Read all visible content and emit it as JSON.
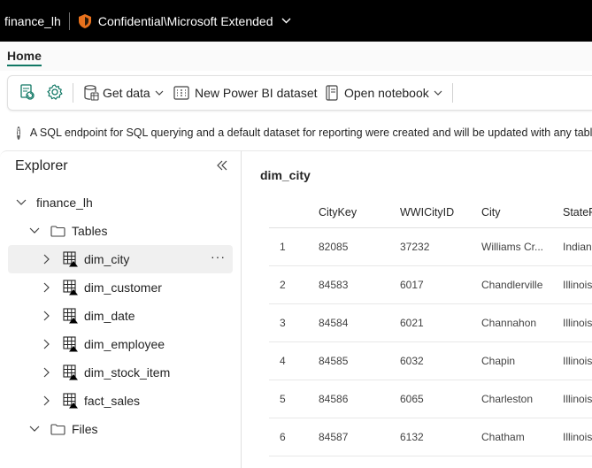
{
  "header": {
    "workspace_item": "finance_lh",
    "sensitivity_label": "Confidential\\Microsoft Extended"
  },
  "tabs": {
    "home": "Home"
  },
  "toolbar": {
    "get_data": "Get data",
    "new_dataset": "New Power BI dataset",
    "open_notebook": "Open notebook"
  },
  "info": {
    "message": "A SQL endpoint for SQL querying and a default dataset for reporting were created and will be updated with any tables"
  },
  "explorer": {
    "title": "Explorer",
    "root": "finance_lh",
    "tables_folder": "Tables",
    "tables": [
      "dim_city",
      "dim_customer",
      "dim_date",
      "dim_employee",
      "dim_stock_item",
      "fact_sales"
    ],
    "files_folder": "Files",
    "selected_more": "···"
  },
  "table": {
    "title": "dim_city",
    "columns": [
      "",
      "CityKey",
      "WWICityID",
      "City",
      "StateP"
    ],
    "rows": [
      [
        "1",
        "82085",
        "37232",
        "Williams Cr...",
        "Indian"
      ],
      [
        "2",
        "84583",
        "6017",
        "Chandlerville",
        "Illinois"
      ],
      [
        "3",
        "84584",
        "6021",
        "Channahon",
        "Illinois"
      ],
      [
        "4",
        "84585",
        "6032",
        "Chapin",
        "Illinois"
      ],
      [
        "5",
        "84586",
        "6065",
        "Charleston",
        "Illinois"
      ],
      [
        "6",
        "84587",
        "6132",
        "Chatham",
        "Illinois"
      ]
    ]
  },
  "colors": {
    "accent": "#117865",
    "topbar": "#000000",
    "sensitivity": "#e8711c"
  }
}
